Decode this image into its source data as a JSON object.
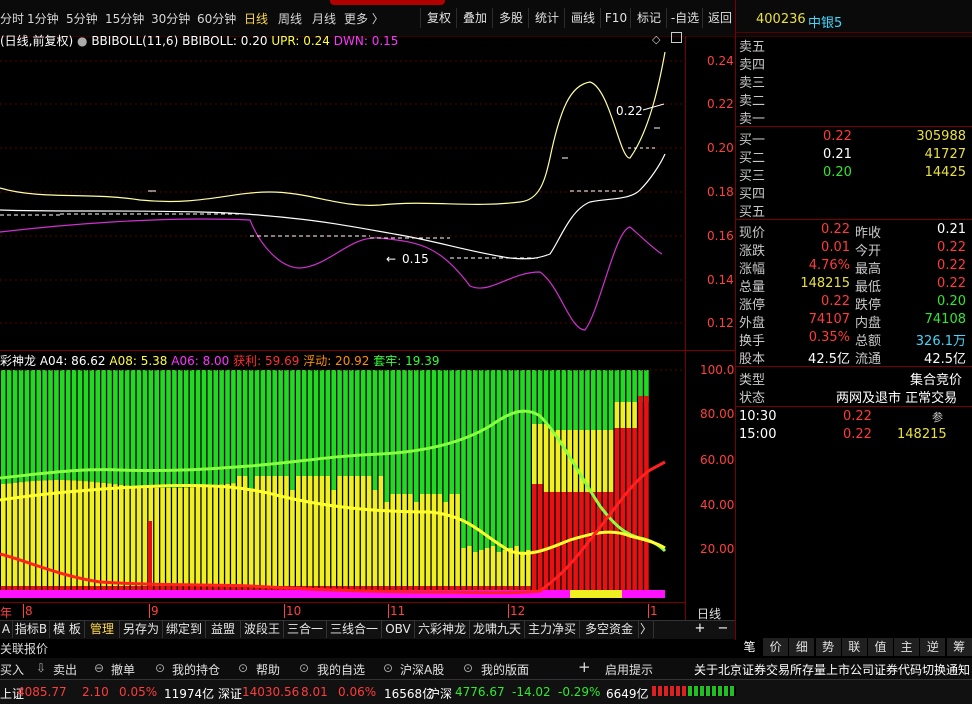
{
  "toolbar": {
    "periods": [
      "分时",
      "1分钟",
      "5分钟",
      "15分钟",
      "30分钟",
      "60分钟",
      "日线",
      "周线",
      "月线",
      "更多 〉"
    ],
    "active_period": "日线",
    "buttons": [
      "复权",
      "叠加",
      "多股",
      "统计",
      "画线",
      "F10",
      "标记",
      "-自选",
      "返回"
    ]
  },
  "indicator1": {
    "prefix": "(日线,前复权)",
    "name": "BBIBOLL(11,6)",
    "bbiboll": "BBIBOLL: 0.20",
    "upr": "UPR: 0.24",
    "dwn": "DWN: 0.15",
    "y_ticks": [
      "0.24",
      "0.22",
      "0.20",
      "0.18",
      "0.16",
      "0.14",
      "0.12"
    ],
    "high_marker": "0.22",
    "low_marker": "0.15"
  },
  "indicator2": {
    "name": "彩神龙",
    "a04": "A04: 86.62",
    "a08": "A08: 5.38",
    "a06": "A06: 8.00",
    "profit": "获利: 59.69",
    "float": "浮动: 20.92",
    "trapped": "套牢: 19.39",
    "y_ticks": [
      "100.0",
      "80.00",
      "60.00",
      "40.00",
      "20.00"
    ]
  },
  "x_axis": {
    "labels": [
      "年",
      "8",
      "9",
      "10",
      "11",
      "12",
      "1"
    ],
    "period_label": "日线",
    "zoom_in": "+",
    "zoom_out": "−"
  },
  "bottom_tabs": [
    "A",
    "指标B",
    "模 板",
    "管理",
    "另存为",
    "绑定到",
    "益盟",
    "波段王",
    "三合一",
    "三线合一",
    "OBV",
    "六彩神龙",
    "龙啸九天",
    "主力净买",
    "多空资金",
    "〉"
  ],
  "active_bottom_tab": "管理",
  "related_quote_label": "关联报价",
  "quote": {
    "code": "400236",
    "name": "中银5",
    "sell_labels": [
      "卖五",
      "卖四",
      "卖三",
      "卖二",
      "卖一"
    ],
    "buy": [
      {
        "label": "买一",
        "price": "0.22",
        "vol": "305988"
      },
      {
        "label": "买二",
        "price": "0.21",
        "vol": "41727"
      },
      {
        "label": "买三",
        "price": "0.20",
        "vol": "14425"
      },
      {
        "label": "买四",
        "price": "",
        "vol": ""
      },
      {
        "label": "买五",
        "price": "",
        "vol": ""
      }
    ],
    "stats": [
      {
        "l1": "现价",
        "v1": "0.22",
        "l2": "昨收",
        "v2": "0.21"
      },
      {
        "l1": "涨跌",
        "v1": "0.01",
        "l2": "今开",
        "v2": "0.22"
      },
      {
        "l1": "涨幅",
        "v1": "4.76%",
        "l2": "最高",
        "v2": "0.22"
      },
      {
        "l1": "总量",
        "v1": "148215",
        "l2": "最低",
        "v2": "0.22"
      },
      {
        "l1": "涨停",
        "v1": "0.22",
        "l2": "跌停",
        "v2": "0.20"
      },
      {
        "l1": "外盘",
        "v1": "74107",
        "l2": "内盘",
        "v2": "74108"
      },
      {
        "l1": "换手",
        "v1": "0.35%",
        "l2": "总额",
        "v2": "326.1万"
      },
      {
        "l1": "股本",
        "v1": "42.5亿",
        "l2": "流通",
        "v2": "42.5亿"
      }
    ],
    "type_label": "类型",
    "type_value": "集合竞价",
    "status_label": "状态",
    "status_value": "两网及退市 正常交易",
    "trades": [
      {
        "time": "10:30",
        "price": "0.22",
        "vol": "",
        "flag": "参"
      },
      {
        "time": "15:00",
        "price": "0.22",
        "vol": "148215",
        "flag": ""
      }
    ]
  },
  "right_tabs": [
    "笔",
    "价",
    "细",
    "势",
    "联",
    "值",
    "主",
    "逆",
    "筹"
  ],
  "active_right_tab": "笔",
  "command_bar": {
    "items": [
      "买入",
      "卖出",
      "撤单",
      "我的持仓",
      "帮助",
      "我的自选",
      "沪深A股",
      "我的版面"
    ],
    "plus": "+",
    "open_tip": "启用提示",
    "notice": "关于北京证券交易所存量上市公司证券代码切换通知"
  },
  "ticker": {
    "sh_label": "上证",
    "sh_value": "4085.77",
    "sh_change": "2.10",
    "sh_pct": "0.05%",
    "sh_amount": "11974亿",
    "sz_label": "深证",
    "sz_value": "14030.56",
    "sz_change": "8.01",
    "sz_pct": "0.06%",
    "sz_amount": "16568亿",
    "hs_label": "沪深",
    "hs_value": "4776.67",
    "hs_change": "-14.02",
    "hs_pct": "-0.29%",
    "hs_amount": "6649亿"
  },
  "colors": {
    "up": "#ff3b3b",
    "down": "#30e830",
    "grid": "#5a0000",
    "bar_green": "#22d822",
    "bar_yellow": "#f0f020",
    "bar_red": "#e81010",
    "bar_magenta": "#ff10ff"
  }
}
